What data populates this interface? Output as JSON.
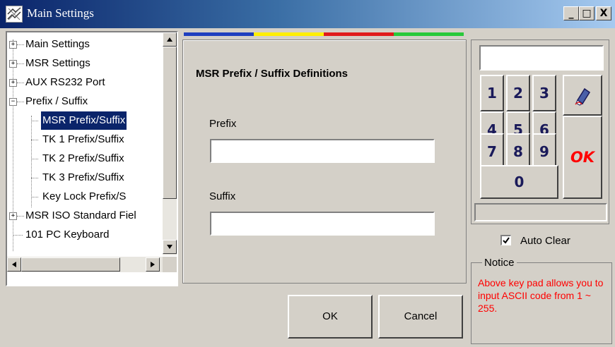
{
  "window": {
    "title": "Main Settings",
    "caption_buttons": {
      "minimize": "_",
      "maximize": "□",
      "close": "X"
    }
  },
  "tree": {
    "items": [
      {
        "label": "Main Settings",
        "expander": "+"
      },
      {
        "label": "MSR Settings",
        "expander": "+"
      },
      {
        "label": "AUX RS232 Port",
        "expander": "+"
      },
      {
        "label": "Prefix / Suffix",
        "expander": "−"
      },
      {
        "label": "MSR   Prefix/Suffix",
        "selected": true
      },
      {
        "label": "TK 1   Prefix/Suffix"
      },
      {
        "label": "TK 2   Prefix/Suffix"
      },
      {
        "label": "TK 3   Prefix/Suffix"
      },
      {
        "label": "Key Lock   Prefix/S"
      },
      {
        "label": "MSR ISO Standard Fiel",
        "expander": "+"
      },
      {
        "label": "101 PC Keyboard"
      }
    ]
  },
  "strip_colors": [
    "#1f3fbf",
    "#ffee00",
    "#e01b1b",
    "#29c93a"
  ],
  "panel": {
    "heading": "MSR Prefix / Suffix Definitions",
    "prefix_label": "Prefix",
    "prefix_value": "",
    "suffix_label": "Suffix",
    "suffix_value": ""
  },
  "buttons": {
    "ok": "OK",
    "cancel": "Cancel"
  },
  "keypad": {
    "display_value": "",
    "keys": [
      "1",
      "2",
      "3",
      "4",
      "5",
      "6",
      "7",
      "8",
      "9",
      "0"
    ],
    "ok_label": "OK",
    "clear_icon": "eraser-icon",
    "status_value": ""
  },
  "auto_clear": {
    "label": "Auto Clear",
    "checked": true
  },
  "notice": {
    "legend": "Notice",
    "text": "Above key pad allows you to input ASCII code from 1 ~ 255."
  }
}
